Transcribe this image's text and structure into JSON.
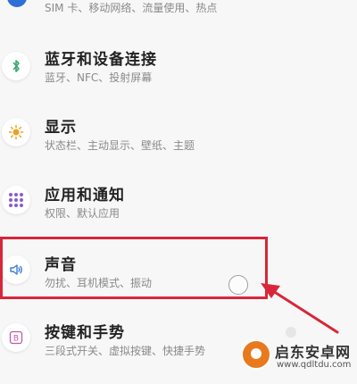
{
  "settings": {
    "items": [
      {
        "subtitle": "SIM 卡、移动网络、流量使用、热点",
        "icon": "sim-network-icon"
      },
      {
        "title": "蓝牙和设备连接",
        "subtitle": "蓝牙、NFC、投射屏幕",
        "icon": "bluetooth-icon"
      },
      {
        "title": "显示",
        "subtitle": "状态栏、主动显示、壁纸、主题",
        "icon": "display-brightness-icon"
      },
      {
        "title": "应用和通知",
        "subtitle": "权限、默认应用",
        "icon": "apps-grid-icon"
      },
      {
        "title": "声音",
        "subtitle": "勿扰、耳机模式、振动",
        "icon": "speaker-icon"
      },
      {
        "title": "按键和手势",
        "subtitle": "三段式开关、虚拟按键、快捷手势",
        "icon": "buttons-gestures-icon"
      }
    ]
  },
  "annotation": {
    "highlight_color": "#d8263a",
    "highlighted_item": "声音"
  },
  "watermark": {
    "title": "启东安卓网",
    "url": "www.qdltdu.com",
    "color": "#e8791d"
  }
}
